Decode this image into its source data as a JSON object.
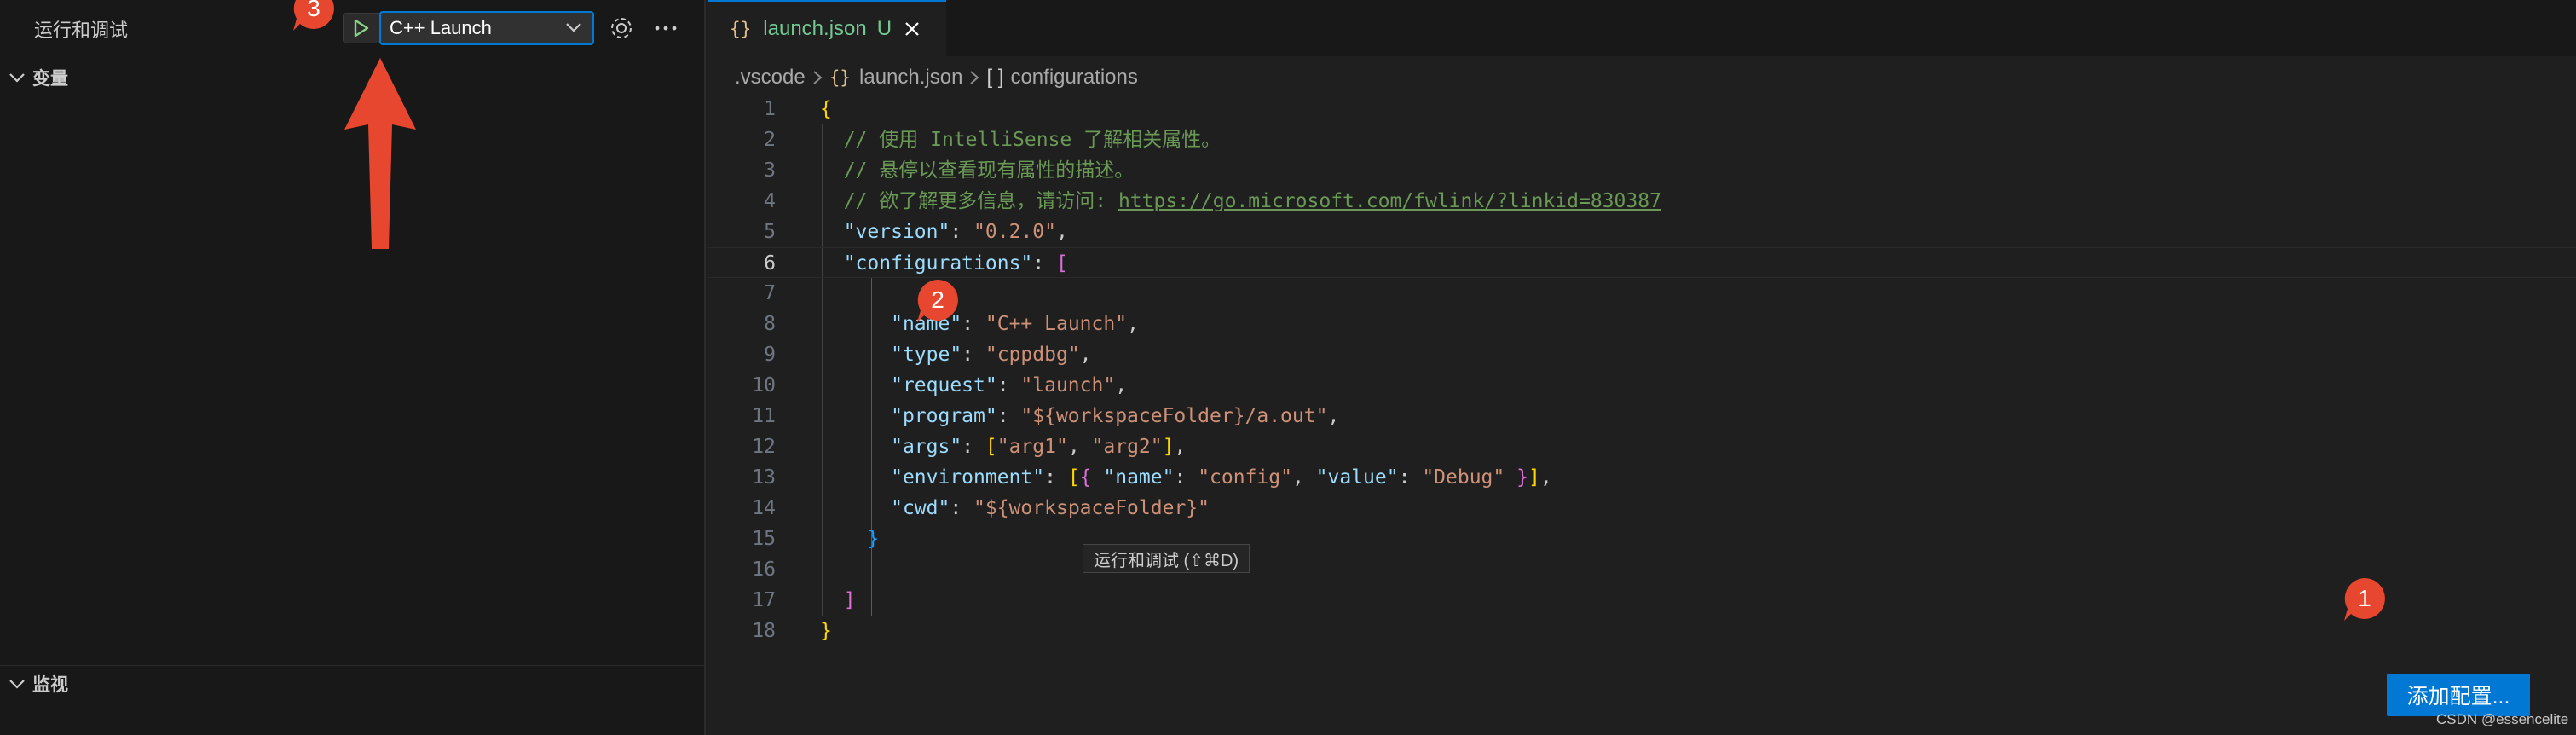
{
  "debug_panel": {
    "title": "运行和调试",
    "selected_config": "C++ Launch",
    "sections": {
      "variables": "变量",
      "watch": "监视"
    }
  },
  "editor": {
    "tab": {
      "braces": "{}",
      "filename": "launch.json",
      "status": "U"
    },
    "breadcrumb": {
      "folder": ".vscode",
      "file_braces": "{}",
      "file": "launch.json",
      "symbol_brackets": "[ ]",
      "symbol": "configurations"
    },
    "line_numbers": [
      "1",
      "2",
      "3",
      "4",
      "5",
      "6",
      "7",
      "8",
      "9",
      "10",
      "11",
      "12",
      "13",
      "14",
      "15",
      "16",
      "17",
      "18"
    ],
    "current_line": 6,
    "code": {
      "l1_open": "{",
      "l2_comment": "// 使用 IntelliSense 了解相关属性。",
      "l3_comment": "// 悬停以查看现有属性的描述。",
      "l4_comment": "// 欲了解更多信息，请访问: ",
      "l4_link": "https://go.microsoft.com/fwlink/?linkid=830387",
      "version_key": "\"version\"",
      "version_val": "\"0.2.0\"",
      "configurations_key": "\"configurations\"",
      "name_key": "\"name\"",
      "name_val": "\"C++ Launch\"",
      "type_key": "\"type\"",
      "type_val": "\"cppdbg\"",
      "request_key": "\"request\"",
      "request_val": "\"launch\"",
      "program_key": "\"program\"",
      "program_val": "\"${workspaceFolder}/a.out\"",
      "args_key": "\"args\"",
      "arg1": "\"arg1\"",
      "arg2": "\"arg2\"",
      "environment_key": "\"environment\"",
      "env_name_key": "\"name\"",
      "env_name_val": "\"config\"",
      "env_value_key": "\"value\"",
      "env_value_val": "\"Debug\"",
      "cwd_key": "\"cwd\"",
      "cwd_val": "\"${workspaceFolder}\""
    },
    "tooltip": "运行和调试 (⇧⌘D)",
    "add_config_button": "添加配置...",
    "watermark": "CSDN @essencelite"
  },
  "annotations": {
    "marker1": "1",
    "marker2": "2",
    "marker3": "3"
  },
  "colors": {
    "accent": "#0078d4",
    "annotation": "#e8472f",
    "string": "#ce9178",
    "key": "#9cdcfe",
    "comment": "#6a9955"
  },
  "icons": [
    "play-icon",
    "chevron-down-icon",
    "gear-icon",
    "ellipsis-icon",
    "close-icon",
    "chevron-right-icon",
    "arrow-up-icon"
  ]
}
